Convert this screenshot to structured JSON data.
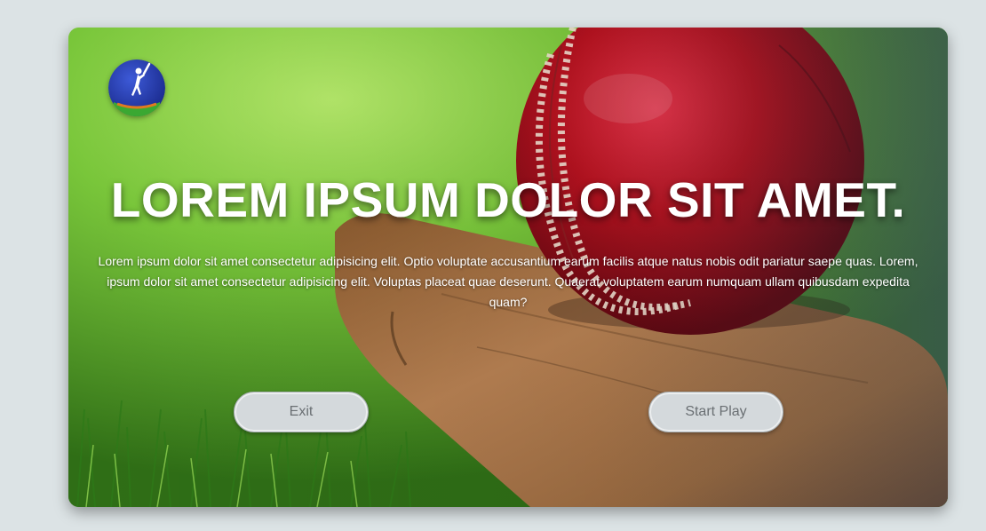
{
  "hero": {
    "title": "LOREM IPSUM DOLOR SIT AMET.",
    "description": "Lorem ipsum dolor sit amet consectetur adipisicing elit. Optio voluptate accusantium earum facilis atque natus nobis odit pariatur saepe quas. Lorem, ipsum dolor sit amet consectetur adipisicing elit. Voluptas placeat quae deserunt. Quaerat voluptatem earum numquam ullam quibusdam expedita quam?"
  },
  "buttons": {
    "exit_label": "Exit",
    "start_label": "Start Play"
  },
  "logo": {
    "icon": "cricket-batsman-icon"
  },
  "colors": {
    "background": "#dce3e5",
    "ball_red": "#b0101c",
    "grass_green": "#5fae2a",
    "button_fill": "#d4d9dc",
    "button_text": "#6a6f73"
  }
}
